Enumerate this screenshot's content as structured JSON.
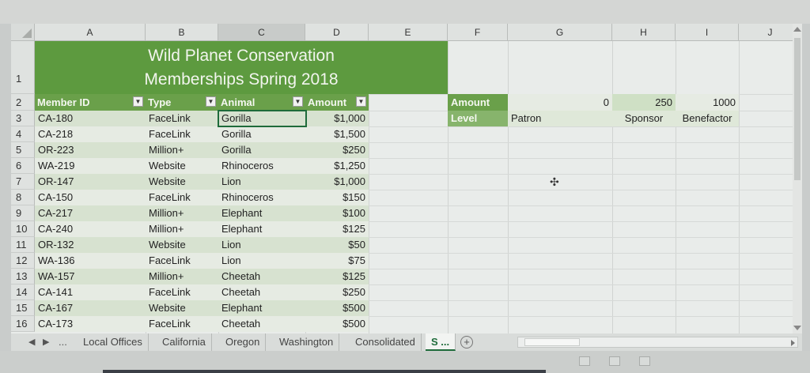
{
  "columns": [
    "A",
    "B",
    "C",
    "D",
    "E",
    "F",
    "G",
    "H",
    "I",
    "J"
  ],
  "rows": [
    "1",
    "2",
    "3",
    "4",
    "5",
    "6",
    "7",
    "8",
    "9",
    "10",
    "11",
    "12",
    "13",
    "14",
    "15",
    "16"
  ],
  "title": {
    "line1": "Wild Planet Conservation",
    "line2": "Memberships Spring 2018"
  },
  "table": {
    "headers": [
      "Member ID",
      "Type",
      "Animal",
      "Amount"
    ],
    "rows": [
      [
        "CA-180",
        "FaceLink",
        "Gorilla",
        "$1,000"
      ],
      [
        "CA-218",
        "FaceLink",
        "Gorilla",
        "$1,500"
      ],
      [
        "OR-223",
        "Million+",
        "Gorilla",
        "$250"
      ],
      [
        "WA-219",
        "Website",
        "Rhinoceros",
        "$1,250"
      ],
      [
        "OR-147",
        "Website",
        "Lion",
        "$1,000"
      ],
      [
        "CA-150",
        "FaceLink",
        "Rhinoceros",
        "$150"
      ],
      [
        "CA-217",
        "Million+",
        "Elephant",
        "$100"
      ],
      [
        "CA-240",
        "Million+",
        "Elephant",
        "$125"
      ],
      [
        "OR-132",
        "Website",
        "Lion",
        "$50"
      ],
      [
        "WA-136",
        "FaceLink",
        "Lion",
        "$75"
      ],
      [
        "WA-157",
        "Million+",
        "Cheetah",
        "$125"
      ],
      [
        "CA-141",
        "FaceLink",
        "Cheetah",
        "$250"
      ],
      [
        "CA-167",
        "Website",
        "Elephant",
        "$500"
      ],
      [
        "CA-173",
        "FaceLink",
        "Cheetah",
        "$500"
      ]
    ]
  },
  "lookup": {
    "amount_label": "Amount",
    "level_label": "Level",
    "amounts": [
      "0",
      "250",
      "1000"
    ],
    "levels": [
      "Patron",
      "Sponsor",
      "Benefactor"
    ]
  },
  "sheet_tabs": [
    "Local Offices",
    "California",
    "Oregon",
    "Washington",
    "Consolidated",
    "S ..."
  ],
  "tab_nav": {
    "prev": "◀",
    "next": "▶",
    "more": "..."
  },
  "colors": {
    "title_green": "#5d9a3f",
    "header_green": "#6aa04a",
    "band_light": "#e6ebe3",
    "band_dark": "#d7e2d0",
    "active_tab": "#1e6b3a"
  },
  "icons": {
    "add_sheet": "plus-circle-icon",
    "cursor": "cell-cursor-icon"
  }
}
